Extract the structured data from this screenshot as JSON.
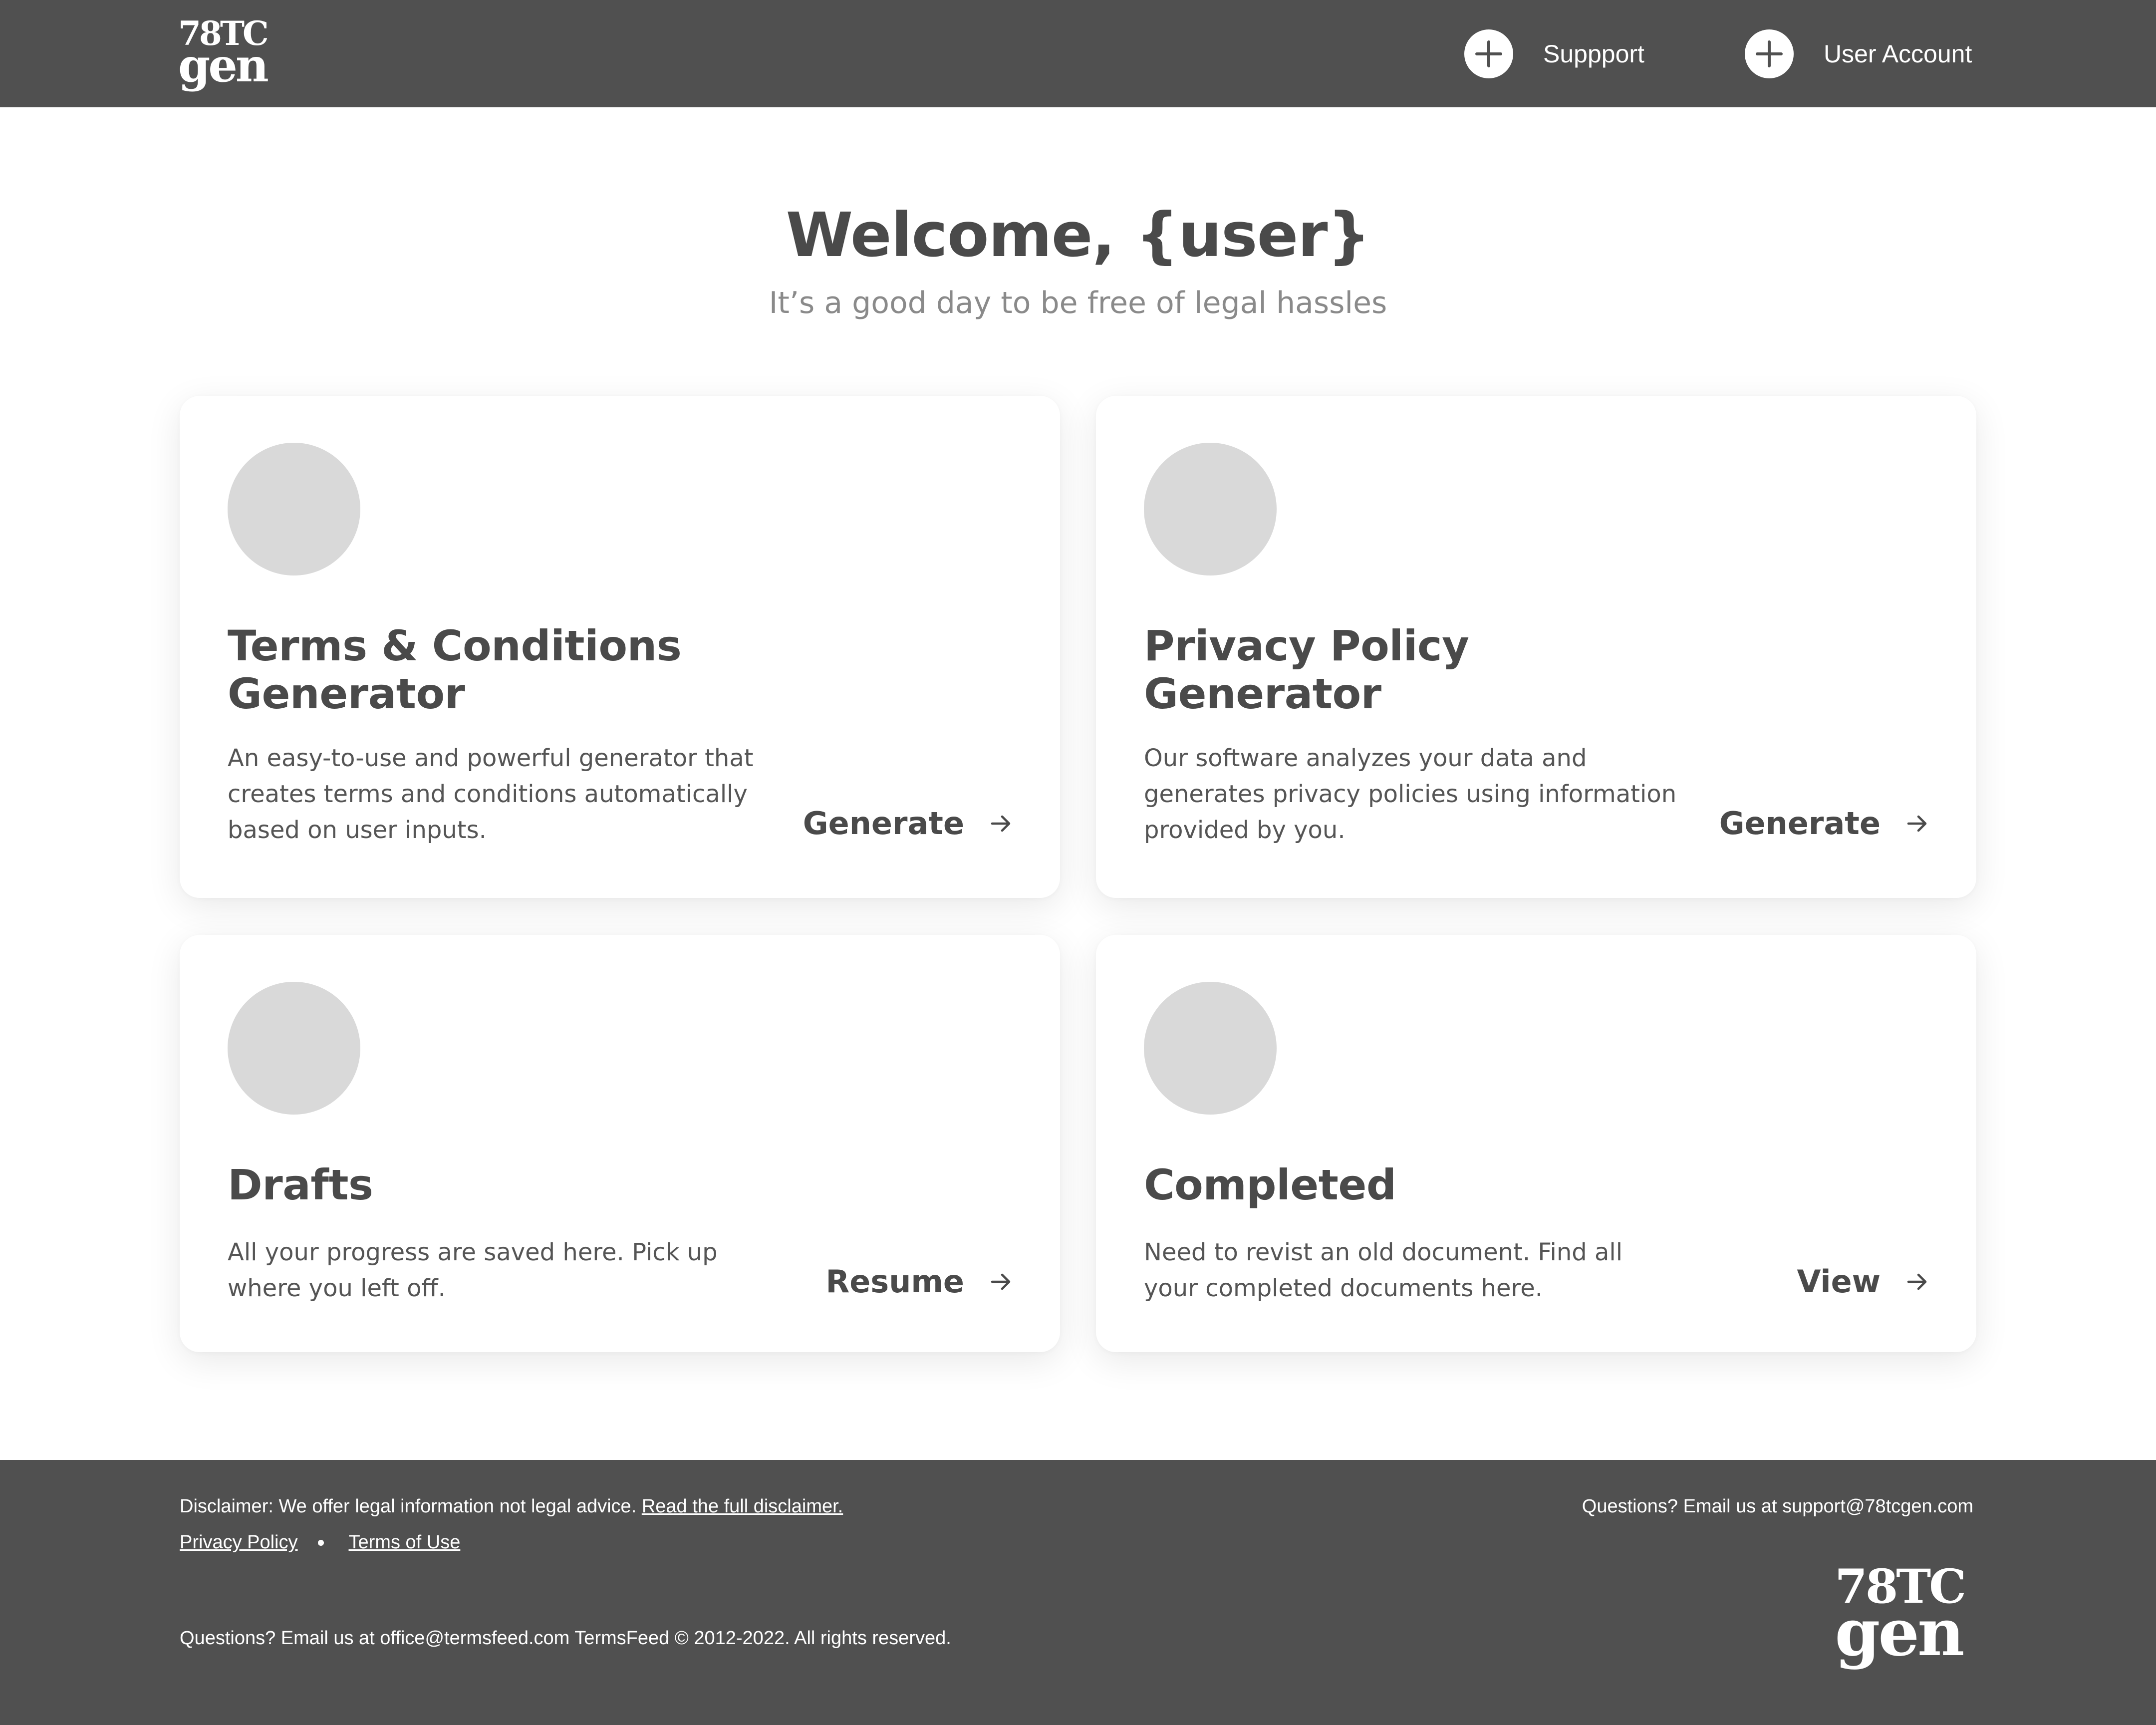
{
  "header": {
    "logo_line1": "78TC",
    "logo_line2": "gen",
    "nav": [
      {
        "label": "Suppport",
        "icon": "plus-icon"
      },
      {
        "label": "User Account",
        "icon": "plus-icon"
      }
    ]
  },
  "hero": {
    "title": "Welcome, {user}",
    "subtitle": "It’s a good day to be free of legal hassles"
  },
  "cards": [
    {
      "title": "Terms & Conditions Generator",
      "description": "An easy-to-use and powerful generator that creates terms and conditions automatically based on user inputs.",
      "action": "Generate",
      "action_icon": "arrow-right-icon"
    },
    {
      "title": "Privacy Policy Generator",
      "description": "Our software analyzes your data and generates privacy policies using information provided by you.",
      "action": "Generate",
      "action_icon": "arrow-right-icon"
    },
    {
      "title": "Drafts",
      "description": "All your progress are saved here. Pick up where you left off.",
      "action": "Resume",
      "action_icon": "arrow-right-icon"
    },
    {
      "title": "Completed",
      "description": "Need to revist an old document. Find all your completed documents here.",
      "action": "View",
      "action_icon": "arrow-right-icon"
    }
  ],
  "footer": {
    "disclaimer_text": "Disclaimer: We offer legal information not legal advice.",
    "disclaimer_link": "Read the full disclaimer.",
    "privacy_link": "Privacy Policy",
    "terms_link": "Terms of Use ",
    "contact_bottom": "Questions? Email us at office@termsfeed.com  TermsFeed © 2012-2022. All rights reserved.",
    "contact_right": "Questions? Email us at support@78tcgen.com",
    "logo_line1": "78TC",
    "logo_line2": "gen"
  },
  "colors": {
    "header_bg": "#505050",
    "footer_bg": "#505050",
    "card_bg": "#ffffff",
    "placeholder_circle": "#d9d9d9",
    "text_dark": "#4a4a4a",
    "text_muted": "#8a8a8a"
  }
}
